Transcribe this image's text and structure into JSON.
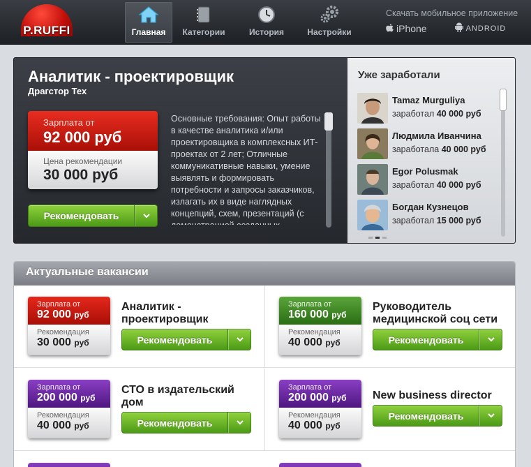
{
  "brand": {
    "name": "P.RUFFI",
    "logo_color": "#d2140c"
  },
  "nav": [
    {
      "label": "Главная",
      "icon": "home-icon",
      "active": true
    },
    {
      "label": "Категории",
      "icon": "categories-icon",
      "active": false
    },
    {
      "label": "История",
      "icon": "clock-icon",
      "active": false
    },
    {
      "label": "Настройки",
      "icon": "gears-icon",
      "active": false
    }
  ],
  "mobile": {
    "title": "Скачать мобильное приложение",
    "iphone": "iPhone",
    "android": "ANDROID"
  },
  "hero": {
    "title": "Аналитик - проектировщик",
    "company": "Драгстор Тех",
    "salary_label": "Зарплата от",
    "salary_value": "92 000 руб",
    "reward_label": "Цена рекомендации",
    "reward_value": "30 000 руб",
    "recommend_label": "Рекомендовать",
    "description": "Основные требования: Опыт работы в качестве аналитика и/или проектировщика в комплексных ИТ-проектах от 2 лет; Отличные коммуникативные навыки, умение выявлять и формировать потребности и запросы заказчиков, излагать их в виде наглядных концепций, схем, презентаций (с демонстрацией созданных"
  },
  "earned": {
    "title": "Уже заработали",
    "people": [
      {
        "name": "Tamaz Murguliya",
        "verb": "заработал",
        "amount": "40 000 руб"
      },
      {
        "name": "Людмила Иванчина",
        "verb": "заработала",
        "amount": "40 000 руб"
      },
      {
        "name": "Egor Polusmak",
        "verb": "заработал",
        "amount": "40 000 руб"
      },
      {
        "name": "Богдан Кузнецов",
        "verb": "заработал",
        "amount": "15 000 руб"
      }
    ]
  },
  "vacancies": {
    "title": "Актуальные вакансии",
    "salary_label": "Зарплата от",
    "reward_label": "Рекомендация",
    "currency": "руб",
    "recommend_label": "Рекомендовать",
    "items": [
      {
        "title": "Аналитик - проектировщик",
        "salary": "92 000",
        "reward": "30 000",
        "color": "red"
      },
      {
        "title": "Руководитель медицинской соц сети",
        "salary": "160 000",
        "reward": "40 000",
        "color": "green"
      },
      {
        "title": "СТО в издательский дом",
        "salary": "200 000",
        "reward": "40 000",
        "color": "purple"
      },
      {
        "title": "New business director",
        "salary": "200 000",
        "reward": "40 000",
        "color": "purple"
      }
    ]
  }
}
